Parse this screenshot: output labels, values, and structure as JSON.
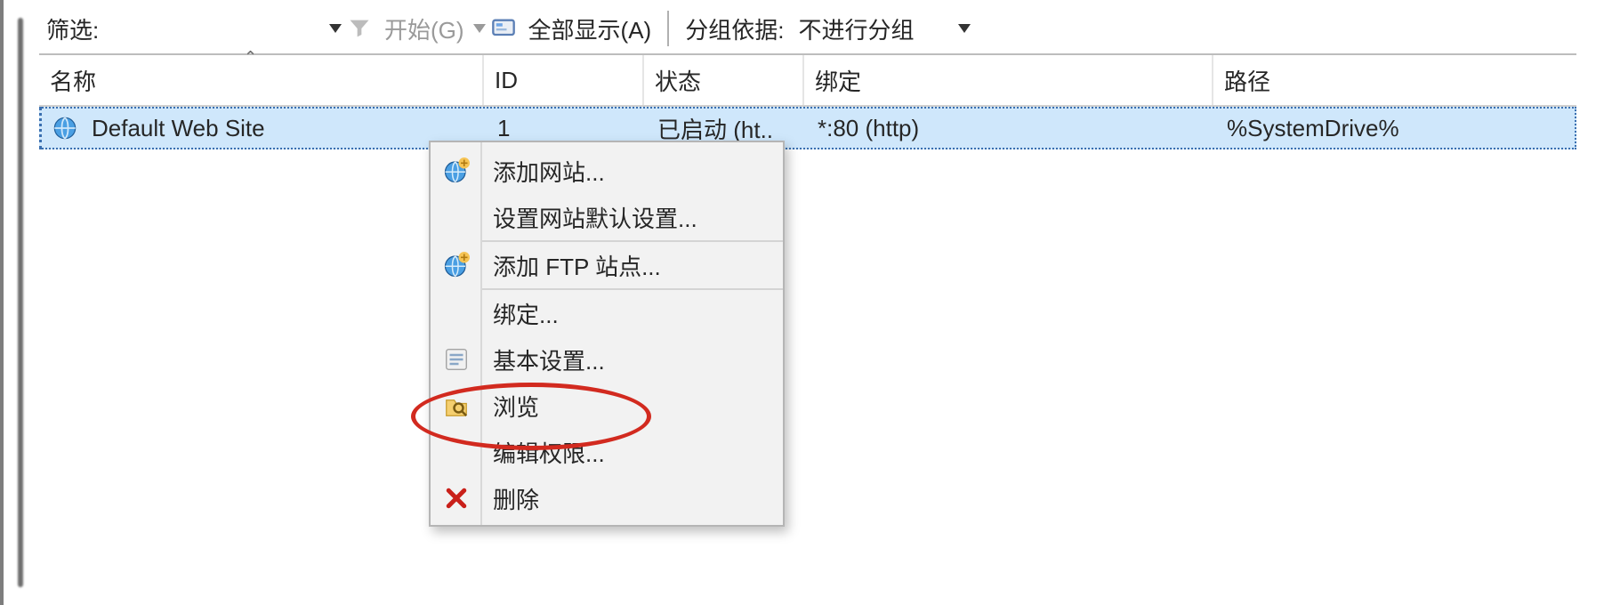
{
  "toolbar": {
    "filter_label": "筛选:",
    "filter_value": "",
    "start_label": "开始(G)",
    "show_all_label": "全部显示(A)",
    "group_by_label": "分组依据:",
    "group_by_value": "不进行分组"
  },
  "columns": {
    "name": "名称",
    "id": "ID",
    "state": "状态",
    "binding": "绑定",
    "path": "路径"
  },
  "rows": [
    {
      "name": "Default Web Site",
      "id": "1",
      "state": "已启动 (ht..",
      "binding": "*:80 (http)",
      "path": "%SystemDrive%"
    }
  ],
  "context_menu": {
    "add_site": "添加网站...",
    "site_defaults": "设置网站默认设置...",
    "add_ftp": "添加 FTP 站点...",
    "bindings": "绑定...",
    "basic_settings": "基本设置...",
    "browse": "浏览",
    "edit_permissions": "编辑权限...",
    "delete": "删除"
  }
}
